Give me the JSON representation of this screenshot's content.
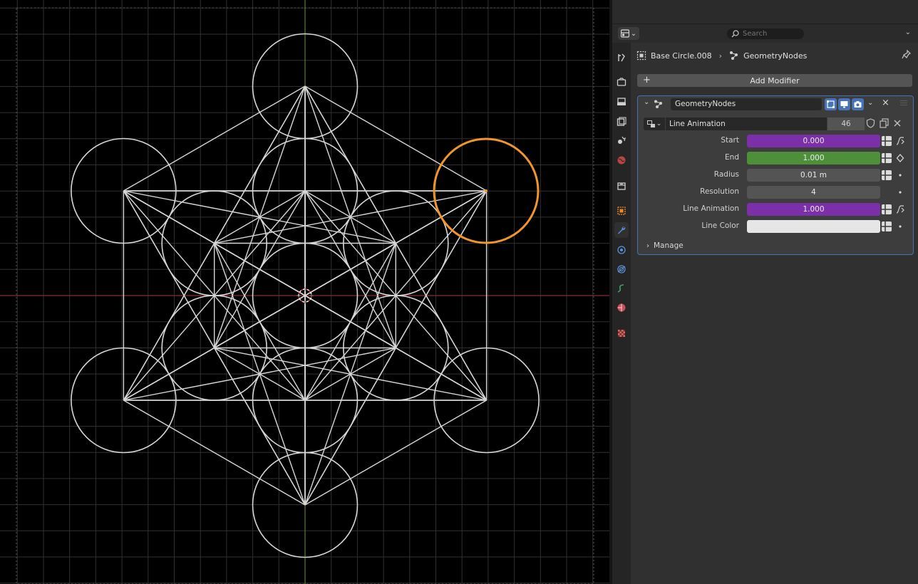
{
  "header": {
    "search_placeholder": "Search"
  },
  "breadcrumb": {
    "object": "Base Circle.008",
    "modifier": "GeometryNodes"
  },
  "add_modifier": {
    "label": "Add Modifier"
  },
  "modifier": {
    "name": "GeometryNodes",
    "node_group": {
      "name": "Line Animation",
      "users": "46"
    },
    "inputs": [
      {
        "label": "Start",
        "value": "0.000",
        "color": "#7b2fa8"
      },
      {
        "label": "End",
        "value": "1.000",
        "color": "#4e8f3a"
      },
      {
        "label": "Radius",
        "value": "0.01 m",
        "color": "#545454"
      },
      {
        "label": "Resolution",
        "value": "4",
        "color": "#545454"
      },
      {
        "label": "Line Animation",
        "value": "1.000",
        "color": "#7b2fa8"
      },
      {
        "label": "Line Color",
        "value": "",
        "color": "#e6e6e6"
      }
    ],
    "manage_label": "Manage"
  },
  "colors": {
    "selection": "#f0962a",
    "x_axis": "#8a2b39",
    "y_axis": "#5c7f19",
    "wireframe": "#d6d6d6",
    "panel_outline": "#4772b3"
  },
  "icons": [
    "editor-type-icon",
    "search-icon",
    "pin-icon",
    "tool-icon",
    "render-icon",
    "output-icon",
    "view-layer-icon",
    "scene-icon",
    "world-icon",
    "collection-icon",
    "object-icon",
    "modifier-wrench-icon",
    "particles-icon",
    "physics-icon",
    "constraints-icon",
    "data-icon",
    "material-icon",
    "texture-icon"
  ]
}
